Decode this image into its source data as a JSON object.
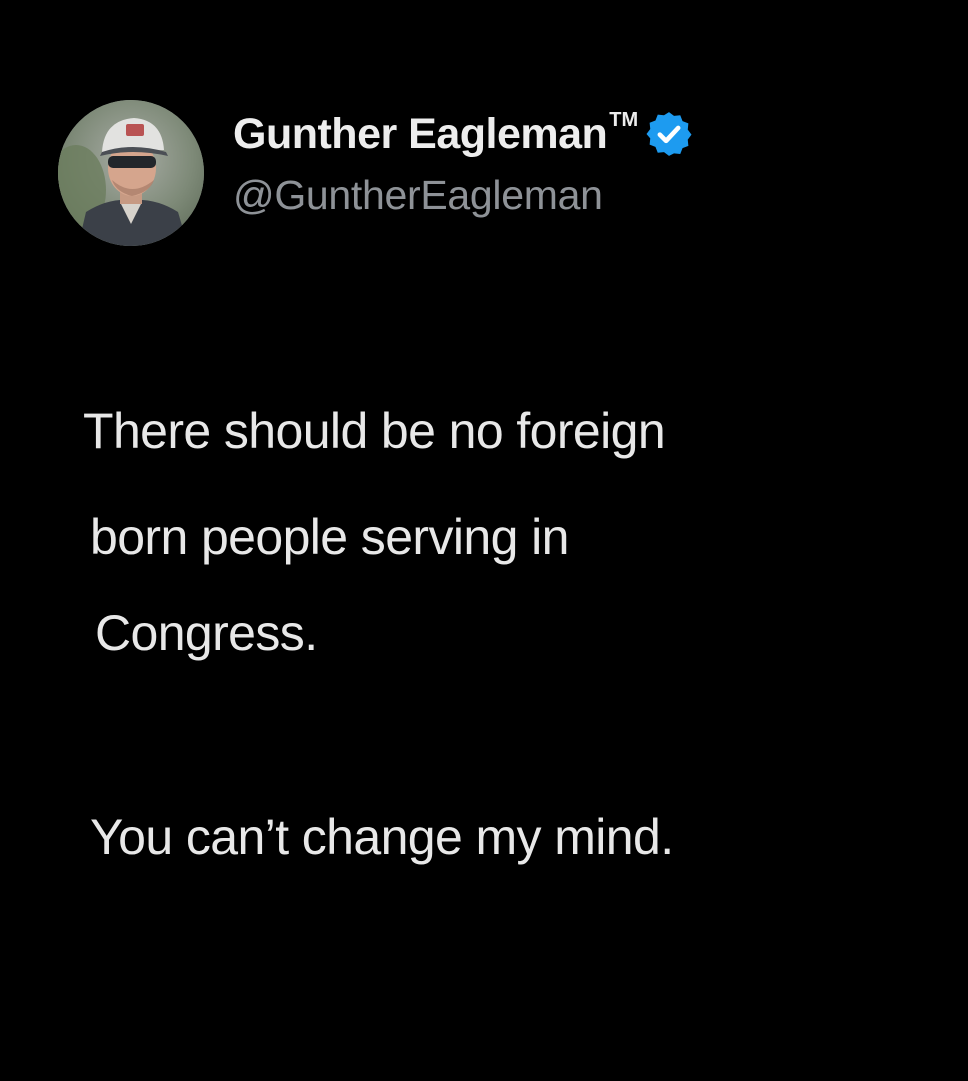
{
  "tweet": {
    "author": {
      "display_name": "Gunther Eagleman",
      "trademark": "TM",
      "handle": "@GuntherEagleman",
      "verified": true,
      "verified_badge_icon": "verified-checkmark-icon",
      "verified_badge_color": "#1d9bf0"
    },
    "text_lines": [
      "There should be no foreign",
      "born people serving in",
      "Congress.",
      "You can’t change my mind."
    ]
  },
  "colors": {
    "background": "#000000",
    "primary_text": "#e8e8e8",
    "secondary_text": "#8e9297"
  }
}
